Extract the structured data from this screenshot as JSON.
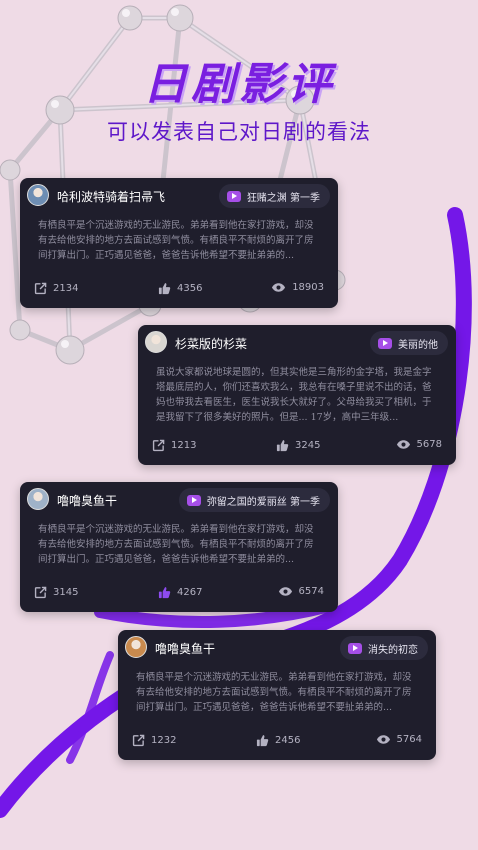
{
  "header": {
    "title": "日剧影评",
    "subtitle": "可以发表自己对日剧的看法"
  },
  "colors": {
    "background": "#efdbe6",
    "accent": "#7a1fe0",
    "card": "#1f1e2c",
    "liked": "#8d4bf0"
  },
  "cards": [
    {
      "user": "哈利波特骑着扫帚飞",
      "avatar_color": "#6d8db3",
      "drama": "狂赌之渊 第一季",
      "review": "有栖良平是个沉迷游戏的无业游民。弟弟看到他在家打游戏，却没有去给他安排的地方去面试感到气愤。有栖良平不耐烦的离开了房间打算出门。正巧遇见爸爸，爸爸告诉他希望不要扯弟弟的...",
      "shares": "2134",
      "likes": "4356",
      "views": "18903",
      "liked": false
    },
    {
      "user": "杉菜版的杉菜",
      "avatar_color": "#d9d6d2",
      "drama": "美丽的他",
      "review": "虽说大家都说地球是圆的，但其实他是三角形的金字塔，我是金字塔最底层的人，你们还喜欢我么，我总有在嗓子里说不出的话，爸妈也带我去看医生，医生说我长大就好了。父母给我买了相机，于是我留下了很多美好的照片。但是... 17岁，高中三年级...",
      "shares": "1213",
      "likes": "3245",
      "views": "5678",
      "liked": false
    },
    {
      "user": "噜噜臭鱼干",
      "avatar_color": "#9fb2c8",
      "drama": "弥留之国的爱丽丝 第一季",
      "review": "有栖良平是个沉迷游戏的无业游民。弟弟看到他在家打游戏，却没有去给他安排的地方去面试感到气愤。有栖良平不耐烦的离开了房间打算出门。正巧遇见爸爸，爸爸告诉他希望不要扯弟弟的...",
      "shares": "3145",
      "likes": "4267",
      "views": "6574",
      "liked": true
    },
    {
      "user": "噜噜臭鱼干",
      "avatar_color": "#c98a4e",
      "drama": "消失的初恋",
      "review": "有栖良平是个沉迷游戏的无业游民。弟弟看到他在家打游戏，却没有去给他安排的地方去面试感到气愤。有栖良平不耐烦的离开了房间打算出门。正巧遇见爸爸，爸爸告诉他希望不要扯弟弟的...",
      "shares": "1232",
      "likes": "2456",
      "views": "5764",
      "liked": false
    }
  ]
}
